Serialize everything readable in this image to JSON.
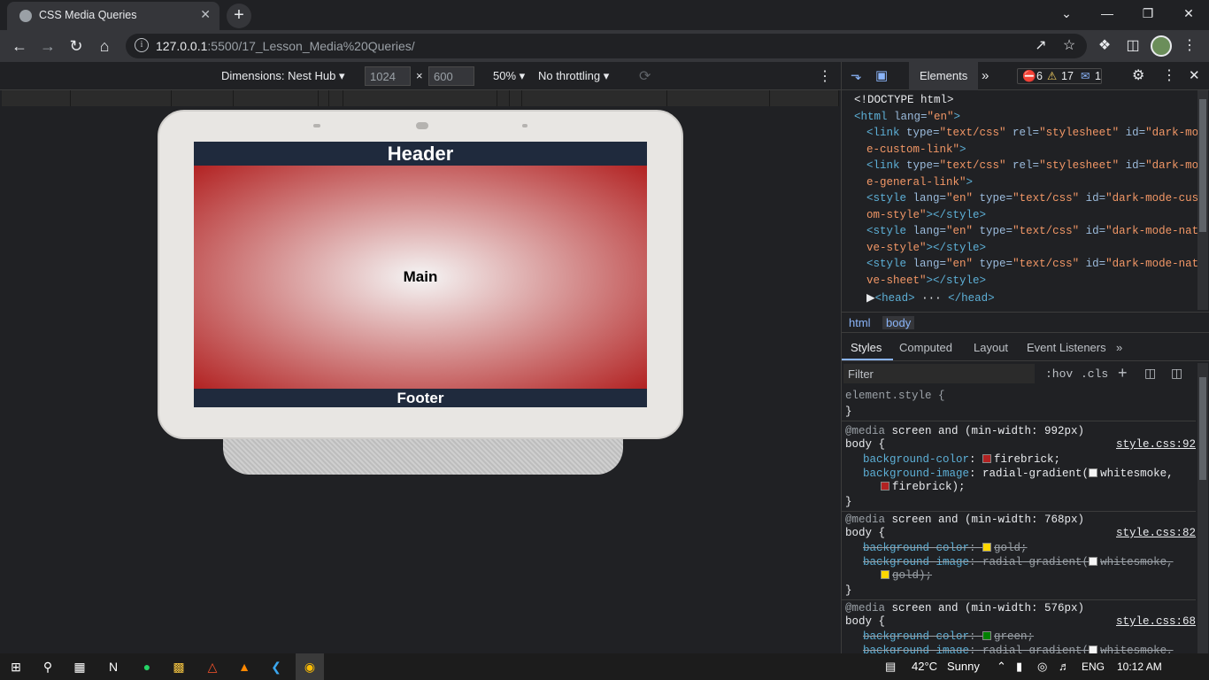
{
  "browser": {
    "tab_title": "CSS Media Queries",
    "tab_close": "✕",
    "new_tab": "+",
    "window": {
      "minimize": "⌄",
      "min": "—",
      "restore": "❐",
      "close": "✕"
    },
    "url_host": "127.0.0.1",
    "url_path": ":5500/17_Lesson_Media%20Queries/",
    "info_icon": "i"
  },
  "device_toolbar": {
    "dimensions_label": "Dimensions: Nest Hub ▾",
    "width_value": "1024",
    "height_value": "600",
    "times": "×",
    "zoom": "50% ▾",
    "throttle": "No throttling ▾"
  },
  "page": {
    "header": "Header",
    "main": "Main",
    "footer": "Footer"
  },
  "devtools": {
    "elements_tab": "Elements",
    "more_tabs": "»",
    "errors": "6",
    "warnings": "17",
    "messages": "1",
    "dom_lines": [
      {
        "indent": 0,
        "parts": [
          [
            "txt",
            "<!DOCTYPE html>"
          ]
        ]
      },
      {
        "indent": 0,
        "parts": [
          [
            "tag",
            "<html "
          ],
          [
            "attr",
            "lang="
          ],
          [
            "val",
            "\"en\""
          ],
          [
            "tag",
            ">"
          ]
        ]
      },
      {
        "indent": 1,
        "parts": [
          [
            "tag",
            "<link "
          ],
          [
            "attr",
            "type="
          ],
          [
            "val",
            "\"text/css\" "
          ],
          [
            "attr",
            "rel="
          ],
          [
            "val",
            "\"stylesheet\" "
          ],
          [
            "attr",
            "id="
          ],
          [
            "val",
            "\"dark-mod"
          ]
        ]
      },
      {
        "indent": 1,
        "parts": [
          [
            "val",
            "e-custom-link\""
          ],
          [
            "tag",
            ">"
          ]
        ]
      },
      {
        "indent": 1,
        "parts": [
          [
            "tag",
            "<link "
          ],
          [
            "attr",
            "type="
          ],
          [
            "val",
            "\"text/css\" "
          ],
          [
            "attr",
            "rel="
          ],
          [
            "val",
            "\"stylesheet\" "
          ],
          [
            "attr",
            "id="
          ],
          [
            "val",
            "\"dark-mod"
          ]
        ]
      },
      {
        "indent": 1,
        "parts": [
          [
            "val",
            "e-general-link\""
          ],
          [
            "tag",
            ">"
          ]
        ]
      },
      {
        "indent": 1,
        "parts": [
          [
            "tag",
            "<style "
          ],
          [
            "attr",
            "lang="
          ],
          [
            "val",
            "\"en\" "
          ],
          [
            "attr",
            "type="
          ],
          [
            "val",
            "\"text/css\" "
          ],
          [
            "attr",
            "id="
          ],
          [
            "val",
            "\"dark-mode-cust"
          ]
        ]
      },
      {
        "indent": 1,
        "parts": [
          [
            "val",
            "om-style\""
          ],
          [
            "tag",
            "></style>"
          ]
        ]
      },
      {
        "indent": 1,
        "parts": [
          [
            "tag",
            "<style "
          ],
          [
            "attr",
            "lang="
          ],
          [
            "val",
            "\"en\" "
          ],
          [
            "attr",
            "type="
          ],
          [
            "val",
            "\"text/css\" "
          ],
          [
            "attr",
            "id="
          ],
          [
            "val",
            "\"dark-mode-nati"
          ]
        ]
      },
      {
        "indent": 1,
        "parts": [
          [
            "val",
            "ve-style\""
          ],
          [
            "tag",
            "></style>"
          ]
        ]
      },
      {
        "indent": 1,
        "parts": [
          [
            "tag",
            "<style "
          ],
          [
            "attr",
            "lang="
          ],
          [
            "val",
            "\"en\" "
          ],
          [
            "attr",
            "type="
          ],
          [
            "val",
            "\"text/css\" "
          ],
          [
            "attr",
            "id="
          ],
          [
            "val",
            "\"dark-mode-nati"
          ]
        ]
      },
      {
        "indent": 1,
        "parts": [
          [
            "val",
            "ve-sheet\""
          ],
          [
            "tag",
            "></style>"
          ]
        ]
      },
      {
        "indent": 1,
        "parts": [
          [
            "txt",
            "▶"
          ],
          [
            "tag",
            "<head>"
          ],
          [
            "txt",
            " ··· "
          ],
          [
            "tag",
            "</head>"
          ]
        ]
      }
    ],
    "crumbs": [
      "html",
      "body"
    ],
    "style_tabs": [
      "Styles",
      "Computed",
      "Layout",
      "Event Listeners",
      "»"
    ],
    "filter_placeholder": "Filter",
    "hov": ":hov",
    "cls": ".cls",
    "element_style": "element.style {",
    "close_brace": "}",
    "rules": [
      {
        "media": "@media screen and (min-width: 992px)",
        "selector": "body {",
        "source": "style.css:92",
        "decls": [
          {
            "prop": "background-color",
            "value": "firebrick;",
            "color": "#b22222",
            "struck": false
          },
          {
            "prop": "background-image",
            "value": "radial-gradient(",
            "value2": "whitesmoke,",
            "cont": "firebrick);",
            "color": "#b22222",
            "struck": false
          }
        ]
      },
      {
        "media": "@media screen and (min-width: 768px)",
        "selector": "body {",
        "source": "style.css:82",
        "decls": [
          {
            "prop": "background-color",
            "value": "gold;",
            "color": "#ffd700",
            "struck": true
          },
          {
            "prop": "background-image",
            "value": "radial-gradient(",
            "value2": "whitesmoke,",
            "cont": "gold);",
            "color": "#ffd700",
            "struck": true
          }
        ]
      },
      {
        "media": "@media screen and (min-width: 576px)",
        "selector": "body {",
        "source": "style.css:68",
        "decls": [
          {
            "prop": "background-color",
            "value": "green;",
            "color": "#008000",
            "struck": true
          },
          {
            "prop": "background-image",
            "value": "radial-gradient(",
            "value2": "whitesmoke,",
            "cont": "",
            "color": "#008000",
            "struck": true
          }
        ]
      }
    ]
  },
  "taskbar": {
    "temp": "42°C",
    "weather": "Sunny",
    "lang": "ENG",
    "time": "10:12 AM"
  }
}
